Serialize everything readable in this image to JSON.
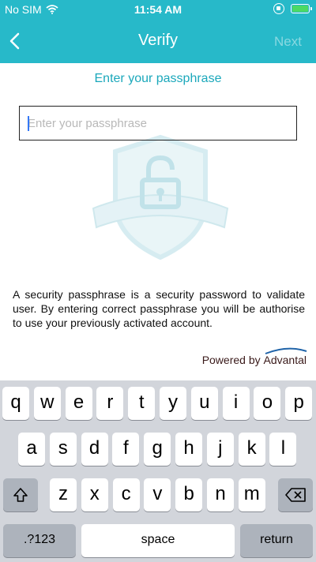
{
  "status_bar": {
    "carrier": "No SIM",
    "time": "11:54 AM"
  },
  "nav": {
    "title": "Verify",
    "next_label": "Next"
  },
  "colors": {
    "accent": "#27b9c9",
    "heading": "#1ba8bb",
    "keyboard_bg": "#d2d5db"
  },
  "form": {
    "heading": "Enter your passphrase",
    "passphrase_placeholder": "Enter your passphrase",
    "passphrase_value": ""
  },
  "description": "A security passphrase is a security password to validate user. By entering correct passphrase you will be authorise to use your previously activated account.",
  "footer": {
    "powered_by": "Powered by",
    "brand": "Advantal"
  },
  "keyboard": {
    "row1": [
      "q",
      "w",
      "e",
      "r",
      "t",
      "y",
      "u",
      "i",
      "o",
      "p"
    ],
    "row2": [
      "a",
      "s",
      "d",
      "f",
      "g",
      "h",
      "j",
      "k",
      "l"
    ],
    "row3": [
      "z",
      "x",
      "c",
      "v",
      "b",
      "n",
      "m"
    ],
    "numbers_label": ".?123",
    "space_label": "space",
    "return_label": "return"
  }
}
